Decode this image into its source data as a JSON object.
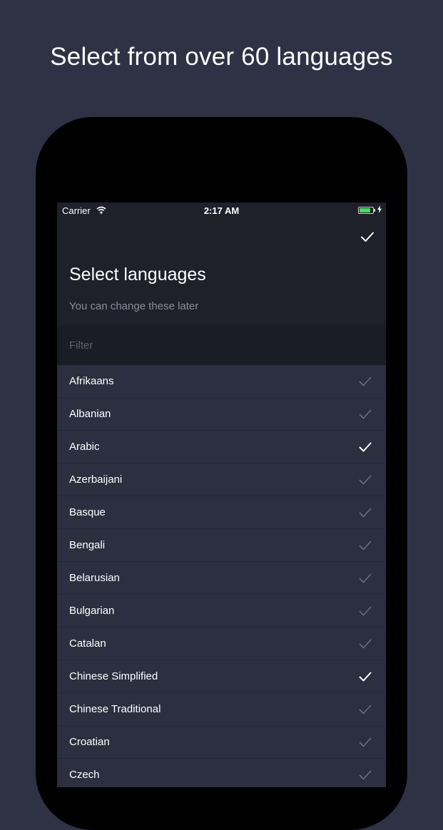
{
  "headline": "Select from over 60 languages",
  "status": {
    "carrier": "Carrier",
    "time": "2:17 AM"
  },
  "header": {
    "title": "Select languages",
    "subtitle": "You can change these later"
  },
  "filter": {
    "placeholder": "Filter",
    "value": ""
  },
  "languages": [
    {
      "label": "Afrikaans",
      "selected": false
    },
    {
      "label": "Albanian",
      "selected": false
    },
    {
      "label": "Arabic",
      "selected": true
    },
    {
      "label": "Azerbaijani",
      "selected": false
    },
    {
      "label": "Basque",
      "selected": false
    },
    {
      "label": "Bengali",
      "selected": false
    },
    {
      "label": "Belarusian",
      "selected": false
    },
    {
      "label": "Bulgarian",
      "selected": false
    },
    {
      "label": "Catalan",
      "selected": false
    },
    {
      "label": "Chinese Simplified",
      "selected": true
    },
    {
      "label": "Chinese Traditional",
      "selected": false
    },
    {
      "label": "Croatian",
      "selected": false
    },
    {
      "label": "Czech",
      "selected": false
    }
  ],
  "colors": {
    "background": "#2f3244",
    "checked": "#ffffff",
    "unchecked": "#6b6e7b"
  },
  "icons": {
    "done": "checkmark-icon",
    "row": "checkmark-icon"
  }
}
